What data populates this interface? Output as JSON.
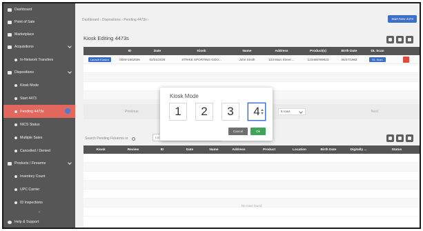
{
  "sidebar": {
    "items": [
      {
        "label": "Dashboard",
        "type": "top"
      },
      {
        "label": "Point of Sale",
        "type": "top"
      },
      {
        "label": "Marketplace",
        "type": "top"
      },
      {
        "label": "Acquisitions",
        "type": "top",
        "chevron": true
      },
      {
        "label": "In-Network Transfers",
        "type": "sub"
      },
      {
        "label": "Dispositions",
        "type": "top",
        "chevron": true
      },
      {
        "label": "Kiosk Mode",
        "type": "sub"
      },
      {
        "label": "Start 4473",
        "type": "sub"
      },
      {
        "label": "Pending 4473s",
        "type": "sub",
        "active": true
      },
      {
        "label": "NICS Status",
        "type": "sub"
      },
      {
        "label": "Multiple Sales",
        "type": "sub"
      },
      {
        "label": "Cancelled / Denied",
        "type": "sub"
      },
      {
        "label": "Products / Firearms",
        "type": "top",
        "chevron": true
      },
      {
        "label": "Inventory Count",
        "type": "sub"
      },
      {
        "label": "UPC Carrier",
        "type": "sub"
      },
      {
        "label": "ID Inspections",
        "type": "sub"
      }
    ],
    "help_label": "Help & Support"
  },
  "header": {
    "breadcrumb": "Dashboard  ›  Dispositions  ›  Pending 4473s  ›",
    "start_button": "Start New 4473"
  },
  "kiosk_panel": {
    "title": "Kiosk Editing 4473s",
    "columns": [
      "",
      "ID",
      "Date",
      "Kiosk",
      "Name",
      "Address",
      "Product(s)",
      "Birth Date",
      "DL Scan",
      ""
    ],
    "rows": [
      {
        "action": "Launch Kiosk ▸",
        "id": "0004-1802026",
        "date": "02/21/2026",
        "kiosk": "STRIKE SPORTING GOO...",
        "name": "John Smith",
        "address": "123 Main Street ...",
        "products": "123456789023",
        "birth_date": "08/27/1982",
        "dl_scan": "DL Scan"
      }
    ],
    "pager": {
      "previous": "Previous",
      "next": "Next",
      "rows_select": "5 rows"
    }
  },
  "pending_panel": {
    "search_label": "Search Pending Firearms or",
    "search_placeholder": "Look",
    "columns": [
      "Kiosk",
      "Review",
      "ID",
      "Date",
      "Name",
      "Address",
      "Product",
      "Location",
      "Birth Date",
      "Digitally ...",
      "Status"
    ],
    "empty_text": "No rows found"
  },
  "modal": {
    "title": "Kiosk Mode",
    "digits": [
      "1",
      "2",
      "3",
      "4"
    ],
    "cancel_label": "Cancel",
    "ok_label": "Ok"
  },
  "colors": {
    "sidebar_bg": "#565656",
    "active_item": "#e2685f",
    "primary": "#3b6fc9",
    "table_header": "#555555",
    "ok_button": "#3fa45a",
    "delete_button": "#e04b3f"
  }
}
